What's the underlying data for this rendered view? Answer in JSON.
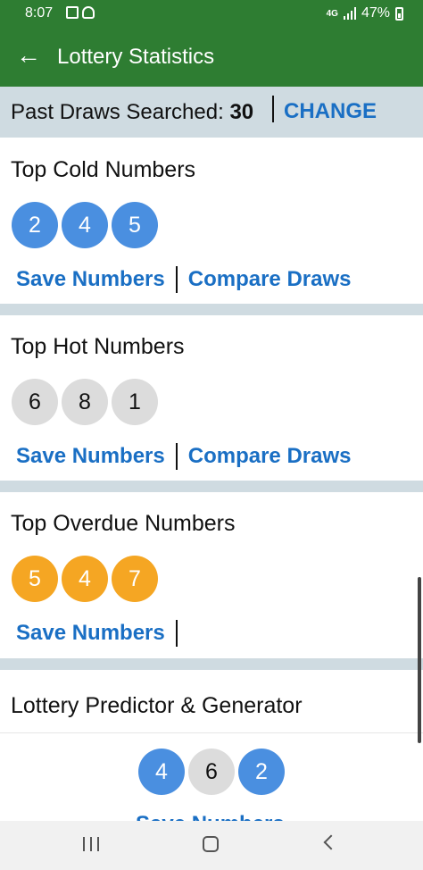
{
  "status": {
    "time": "8:07",
    "network": "4G",
    "battery": "47%",
    "left_icons": [
      "image-icon",
      "incognito-icon"
    ]
  },
  "appbar": {
    "back_icon": "arrow-left-icon",
    "title": "Lottery Statistics"
  },
  "past_draws": {
    "label": "Past Draws Searched:",
    "value": "30",
    "change": "CHANGE"
  },
  "sections": {
    "cold": {
      "title": "Top Cold Numbers",
      "numbers": [
        "2",
        "4",
        "5"
      ],
      "ball_color": "#4a8fe0",
      "save": "Save Numbers",
      "compare": "Compare Draws"
    },
    "hot": {
      "title": "Top Hot Numbers",
      "numbers": [
        "6",
        "8",
        "1"
      ],
      "ball_color": "#dcdcdc",
      "save": "Save Numbers",
      "compare": "Compare Draws"
    },
    "overdue": {
      "title": "Top Overdue Numbers",
      "numbers": [
        "5",
        "4",
        "7"
      ],
      "ball_color": "#f5a623",
      "save": "Save Numbers"
    },
    "predictor": {
      "title": "Lottery Predictor & Generator",
      "numbers": [
        "4",
        "6",
        "2"
      ],
      "ball_colors": [
        "#4a8fe0",
        "#dcdcdc",
        "#4a8fe0"
      ],
      "save_partial": "Save Numbers"
    }
  },
  "colors": {
    "header_green": "#2e7d32",
    "link_blue": "#1a6fc4",
    "divider": "#cfdbe1"
  },
  "navbar": {
    "icons": [
      "recent-apps-icon",
      "home-icon",
      "back-icon"
    ]
  }
}
